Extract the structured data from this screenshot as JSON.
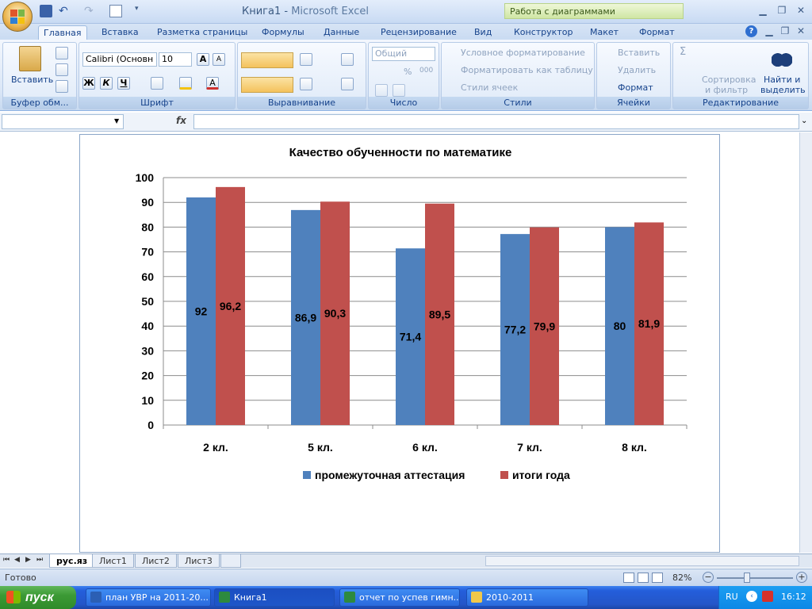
{
  "window": {
    "title": "Книга1",
    "app": "Microsoft Excel",
    "context_tab": "Работа с диаграммами"
  },
  "tabs": [
    "Главная",
    "Вставка",
    "Разметка страницы",
    "Формулы",
    "Данные",
    "Рецензирование",
    "Вид",
    "Конструктор",
    "Макет",
    "Формат"
  ],
  "ribbon": {
    "clipboard": {
      "paste": "Вставить",
      "label": "Буфер обм..."
    },
    "font": {
      "name": "Calibri (Основн",
      "size": "10",
      "label": "Шрифт",
      "bold": "Ж",
      "italic": "К",
      "underline": "Ч"
    },
    "alignment": {
      "label": "Выравнивание"
    },
    "number": {
      "format": "Общий",
      "percent": "%",
      "thousands": "000",
      "label": "Число"
    },
    "styles": {
      "conditional": "Условное форматирование",
      "as_table": "Форматировать как таблицу",
      "cell_styles": "Стили ячеек",
      "label": "Стили"
    },
    "cells": {
      "insert": "Вставить",
      "delete": "Удалить",
      "format": "Формат",
      "label": "Ячейки"
    },
    "editing": {
      "sigma": "Σ",
      "sort_line1": "Сортировка",
      "sort_line2": "и фильтр",
      "find_line1": "Найти и",
      "find_line2": "выделить",
      "label": "Редактирование"
    }
  },
  "formula_bar": {
    "fx": "fx",
    "value": ""
  },
  "chart_data": {
    "type": "bar",
    "title": "Качество обученности по математике",
    "categories": [
      "2 кл.",
      "5 кл.",
      "6 кл.",
      "7 кл.",
      "8 кл."
    ],
    "series": [
      {
        "name": "промежуточная  аттестация",
        "color": "#4f81bd",
        "values": [
          92,
          86.9,
          71.4,
          77.2,
          80
        ],
        "labels": [
          "92",
          "86,9",
          "71,4",
          "77,2",
          "80"
        ]
      },
      {
        "name": "итоги года",
        "color": "#c0504d",
        "values": [
          96.2,
          90.3,
          89.5,
          79.9,
          81.9
        ],
        "labels": [
          "96,2",
          "90,3",
          "89,5",
          "79,9",
          "81,9"
        ]
      }
    ],
    "yticks": [
      "0",
      "10",
      "20",
      "30",
      "40",
      "50",
      "60",
      "70",
      "80",
      "90",
      "100"
    ],
    "ylim": [
      0,
      100
    ],
    "grid": true,
    "legend": "bottom"
  },
  "sheets": [
    "рус.яз",
    "Лист1",
    "Лист2",
    "Лист3"
  ],
  "status": {
    "text": "Готово",
    "zoom": "82%"
  },
  "taskbar": {
    "start": "пуск",
    "items": [
      "план УВР на 2011-20...",
      "Книга1",
      "отчет по успев гимн...",
      "2010-2011"
    ],
    "lang": "RU",
    "time": "16:12"
  }
}
